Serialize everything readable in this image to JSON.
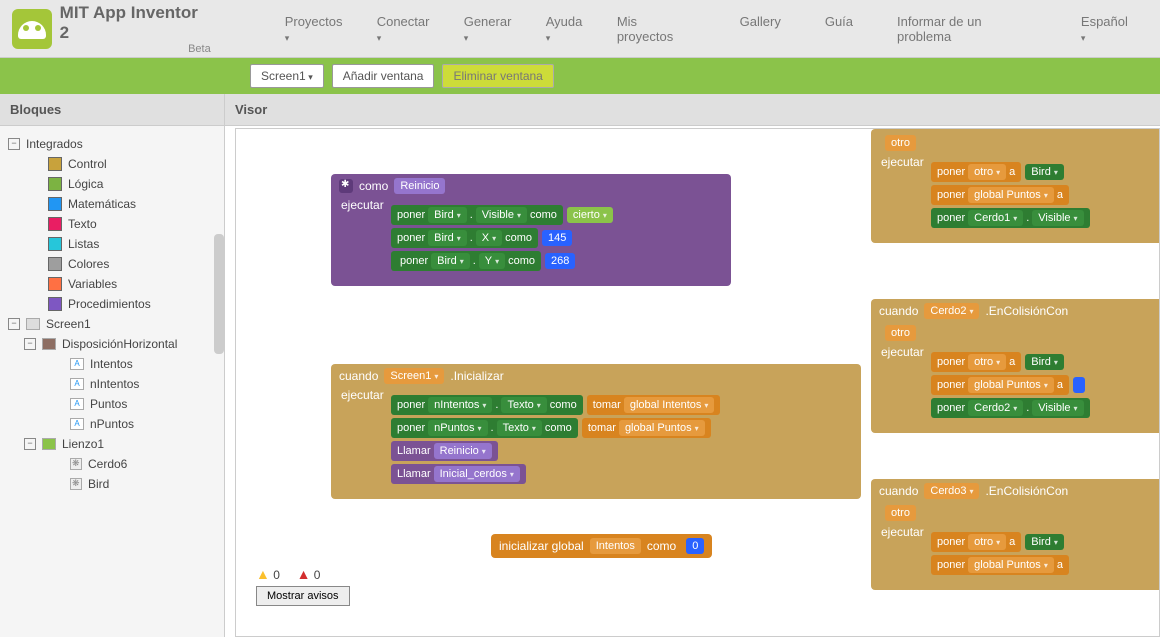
{
  "header": {
    "title": "MIT App Inventor 2",
    "beta": "Beta",
    "menu": [
      "Proyectos",
      "Conectar",
      "Generar",
      "Ayuda"
    ],
    "right": [
      {
        "label": "Mis proyectos",
        "dd": false
      },
      {
        "label": "Gallery",
        "dd": false
      },
      {
        "label": "Guía",
        "dd": false
      },
      {
        "label": "Informar de un problema",
        "dd": false
      },
      {
        "label": "Español",
        "dd": true
      }
    ]
  },
  "greenbar": {
    "screen": "Screen1",
    "add": "Añadir ventana",
    "remove": "Eliminar ventana"
  },
  "sidebar": {
    "title": "Bloques",
    "builtin_label": "Integrados",
    "builtin": [
      "Control",
      "Lógica",
      "Matemáticas",
      "Texto",
      "Listas",
      "Colores",
      "Variables",
      "Procedimientos"
    ],
    "screen": "Screen1",
    "disp": "DisposiciónHorizontal",
    "labels": [
      "Intentos",
      "nIntentos",
      "Puntos",
      "nPuntos"
    ],
    "canvas": "Lienzo1",
    "sprites": [
      "Cerdo6",
      "Bird"
    ]
  },
  "visor": {
    "title": "Visor"
  },
  "warnings": {
    "warn": "0",
    "err": "0",
    "btn": "Mostrar avisos"
  },
  "blk1": {
    "como": "como",
    "name": "Reinicio",
    "exec": "ejecutar",
    "r1": {
      "poner": "poner",
      "obj": "Bird",
      "prop": "Visible",
      "como": "como",
      "val": "cierto"
    },
    "r2": {
      "poner": "poner",
      "obj": "Bird",
      "prop": "X",
      "como": "como",
      "val": "145"
    },
    "r3": {
      "poner": "poner",
      "obj": "Bird",
      "prop": "Y",
      "como": "como",
      "val": "268"
    }
  },
  "blk2": {
    "cuando": "cuando",
    "obj": "Screen1",
    "evt": ".Inicializar",
    "exec": "ejecutar",
    "r1": {
      "poner": "poner",
      "obj": "nIntentos",
      "prop": "Texto",
      "como": "como",
      "tomar": "tomar",
      "var": "global Intentos"
    },
    "r2": {
      "poner": "poner",
      "obj": "nPuntos",
      "prop": "Texto",
      "como": "como",
      "tomar": "tomar",
      "var": "global Puntos"
    },
    "r3": {
      "llamar": "Llamar",
      "proc": "Reinicio"
    },
    "r4": {
      "llamar": "Llamar",
      "proc": "Inicial_cerdos"
    }
  },
  "blk3": {
    "init": "inicializar global",
    "name": "Intentos",
    "como": "como",
    "val": "0"
  },
  "blk4": {
    "otro": "otro",
    "exec": "ejecutar",
    "r1": {
      "poner": "poner",
      "var": "otro",
      "a": "a",
      "val": "Bird"
    },
    "r2": {
      "poner": "poner",
      "var": "global Puntos",
      "a": "a"
    },
    "r3": {
      "poner": "poner",
      "obj": "Cerdo1",
      "prop": "Visible"
    }
  },
  "blk5": {
    "cuando": "cuando",
    "obj": "Cerdo2",
    "evt": ".EnColisiónCon",
    "otro": "otro",
    "exec": "ejecutar",
    "r1": {
      "poner": "poner",
      "var": "otro",
      "a": "a",
      "val": "Bird"
    },
    "r2": {
      "poner": "poner",
      "var": "global Puntos",
      "a": "a"
    },
    "r3": {
      "poner": "poner",
      "obj": "Cerdo2",
      "prop": "Visible"
    }
  },
  "blk6": {
    "cuando": "cuando",
    "obj": "Cerdo3",
    "evt": ".EnColisiónCon",
    "otro": "otro",
    "exec": "ejecutar",
    "r1": {
      "poner": "poner",
      "var": "otro",
      "a": "a",
      "val": "Bird"
    },
    "r2": {
      "poner": "poner",
      "var": "global Puntos",
      "a": "a"
    }
  }
}
